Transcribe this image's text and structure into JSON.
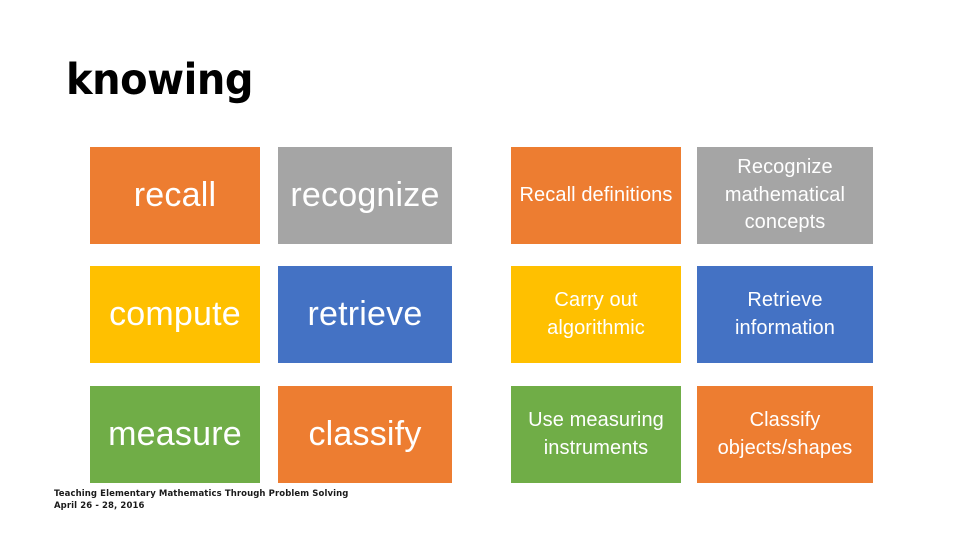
{
  "slide": {
    "title": "knowing",
    "background_color": "#FFFFFF"
  },
  "palette": {
    "orange": "#ED7D31",
    "gray": "#A5A5A5",
    "gold": "#FFC000",
    "blue": "#4472C4",
    "green": "#70AD47",
    "text_on_tile": "#FFFFFF",
    "title_color": "#000000"
  },
  "grid": {
    "rows": 3,
    "columns": 4,
    "tiles": [
      {
        "id": "tile-recall",
        "row": 1,
        "column": 1,
        "group": "keyword",
        "label": "recall",
        "color": "#ED7D31"
      },
      {
        "id": "tile-recognize",
        "row": 1,
        "column": 2,
        "group": "keyword",
        "label": "recognize",
        "color": "#A5A5A5"
      },
      {
        "id": "tile-recall-definitions",
        "row": 1,
        "column": 3,
        "group": "phrase",
        "label": "Recall definitions",
        "color": "#ED7D31"
      },
      {
        "id": "tile-recognize-math-concepts",
        "row": 1,
        "column": 4,
        "group": "phrase",
        "label": "Recognize mathematical concepts",
        "color": "#A5A5A5"
      },
      {
        "id": "tile-compute",
        "row": 2,
        "column": 1,
        "group": "keyword",
        "label": "compute",
        "color": "#FFC000"
      },
      {
        "id": "tile-retrieve",
        "row": 2,
        "column": 2,
        "group": "keyword",
        "label": "retrieve",
        "color": "#4472C4"
      },
      {
        "id": "tile-carry-out-algorithmic",
        "row": 2,
        "column": 3,
        "group": "phrase",
        "label": "Carry out algorithmic",
        "color": "#FFC000"
      },
      {
        "id": "tile-retrieve-information",
        "row": 2,
        "column": 4,
        "group": "phrase",
        "label": "Retrieve information",
        "color": "#4472C4"
      },
      {
        "id": "tile-measure",
        "row": 3,
        "column": 1,
        "group": "keyword",
        "label": "measure",
        "color": "#70AD47"
      },
      {
        "id": "tile-classify",
        "row": 3,
        "column": 2,
        "group": "keyword",
        "label": "classify",
        "color": "#ED7D31"
      },
      {
        "id": "tile-use-measuring-instruments",
        "row": 3,
        "column": 3,
        "group": "phrase",
        "label": "Use measuring instruments",
        "color": "#70AD47"
      },
      {
        "id": "tile-classify-objects-shapes",
        "row": 3,
        "column": 4,
        "group": "phrase",
        "label": "Classify objects/shapes",
        "color": "#ED7D31"
      }
    ]
  },
  "footer": {
    "line1": "Teaching Elementary Mathematics Through Problem Solving",
    "line2": "April 26 - 28, 2016"
  }
}
